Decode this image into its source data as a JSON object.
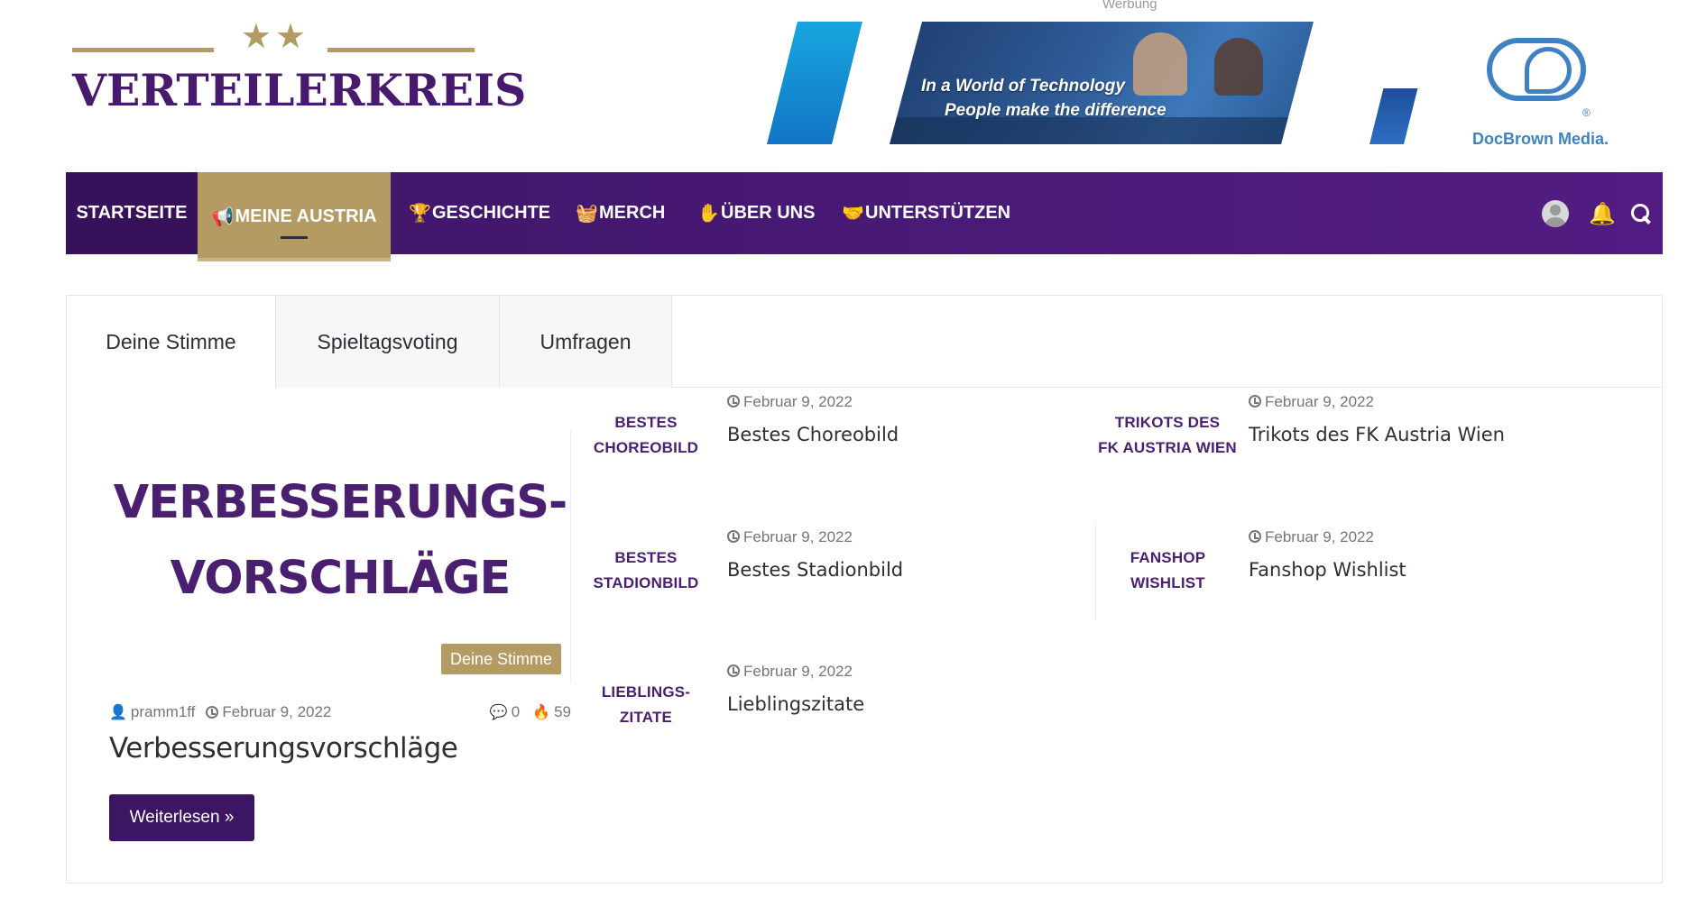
{
  "header": {
    "logo_stars": "★★",
    "logo_text": "VERTEILERKREIS",
    "ad_label": "Werbung",
    "ad_tagline_1": "In a World of Technology",
    "ad_tagline_2": "People make the difference",
    "ad_logo_reg": "®",
    "ad_brand": "DocBrown Media."
  },
  "nav": {
    "items": [
      {
        "label": "STARTSEITE",
        "icon": ""
      },
      {
        "label": "MEINE AUSTRIA",
        "icon": "megaphone-icon"
      },
      {
        "label": "GESCHICHTE",
        "icon": "trophy-icon"
      },
      {
        "label": "MERCH",
        "icon": "basket-icon"
      },
      {
        "label": "ÜBER UNS",
        "icon": "hand-icon"
      },
      {
        "label": "UNTERSTÜTZEN",
        "icon": "handshake-icon"
      }
    ],
    "active_index": 1,
    "right_icons": [
      "user-avatar-icon",
      "bell-icon",
      "search-icon"
    ]
  },
  "tabs": [
    {
      "label": "Deine Stimme",
      "active": true
    },
    {
      "label": "Spieltagsvoting",
      "active": false
    },
    {
      "label": "Umfragen",
      "active": false
    }
  ],
  "featured": {
    "image_line_1": "VERBESSERUNGS-",
    "image_line_2": "VORSCHLÄGE",
    "category_badge": "Deine Stimme",
    "author": "pramm1ff",
    "date": "Februar 9, 2022",
    "comments": "0",
    "views": "59",
    "title": "Verbesserungsvorschläge",
    "button_label": "Weiterlesen »"
  },
  "posts": [
    {
      "thumb_1": "BESTES",
      "thumb_2": "CHOREOBILD",
      "date": "Februar 9, 2022",
      "title": "Bestes Choreobild"
    },
    {
      "thumb_1": "TRIKOTS DES",
      "thumb_2": "FK AUSTRIA WIEN",
      "date": "Februar 9, 2022",
      "title": "Trikots des FK Austria Wien"
    },
    {
      "thumb_1": "BESTES",
      "thumb_2": "STADIONBILD",
      "date": "Februar 9, 2022",
      "title": "Bestes Stadionbild"
    },
    {
      "thumb_1": "FANSHOP",
      "thumb_2": "WISHLIST",
      "date": "Februar 9, 2022",
      "title": "Fanshop Wishlist"
    },
    {
      "thumb_1": "LIEBLINGS-",
      "thumb_2": "ZITATE",
      "date": "Februar 9, 2022",
      "title": "Lieblingszitate"
    }
  ],
  "colors": {
    "brand_purple": "#471a6e",
    "gold": "#b49b64",
    "nav_bg": "#4a1a78",
    "button_bg": "#3c1663"
  }
}
